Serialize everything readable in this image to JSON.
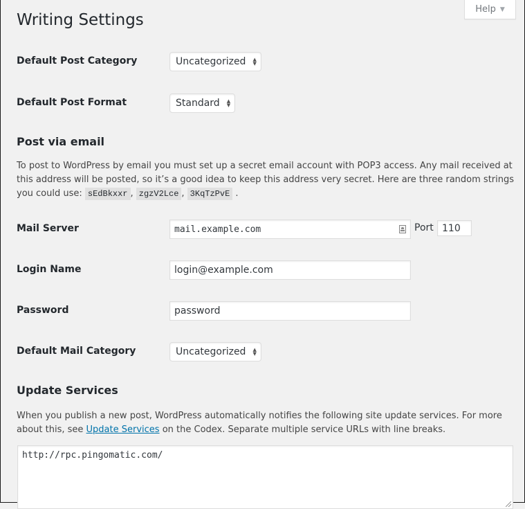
{
  "help_tab": {
    "label": "Help",
    "arrow_icon": "triangle-down"
  },
  "page_title": "Writing Settings",
  "fields": {
    "default_post_category": {
      "label": "Default Post Category",
      "value": "Uncategorized"
    },
    "default_post_format": {
      "label": "Default Post Format",
      "value": "Standard"
    }
  },
  "post_via_email": {
    "heading": "Post via email",
    "description_before": "To post to WordPress by email you must set up a secret email account with POP3 access. Any mail received at this address will be posted, so it’s a good idea to keep this address very secret. Here are three random strings you could use:",
    "random_strings": [
      "sEdBkxxr",
      "zgzV2Lce",
      "3KqTzPvE"
    ],
    "separator": ",",
    "end": ".",
    "mail_server": {
      "label": "Mail Server",
      "value": "mail.example.com",
      "icon": "contact-card-icon"
    },
    "port": {
      "label": "Port",
      "value": "110"
    },
    "login_name": {
      "label": "Login Name",
      "value": "login@example.com"
    },
    "password": {
      "label": "Password",
      "value": "password"
    },
    "default_mail_category": {
      "label": "Default Mail Category",
      "value": "Uncategorized"
    }
  },
  "update_services": {
    "heading": "Update Services",
    "description_1": "When you publish a new post, WordPress automatically notifies the following site update services. For more about this, see ",
    "link_text": "Update Services",
    "description_2": " on the Codex. Separate multiple service URLs with line breaks.",
    "textarea_value": "http://rpc.pingomatic.com/"
  },
  "colors": {
    "background": "#f1f1f1",
    "link": "#0073aa",
    "text": "#23282d"
  }
}
